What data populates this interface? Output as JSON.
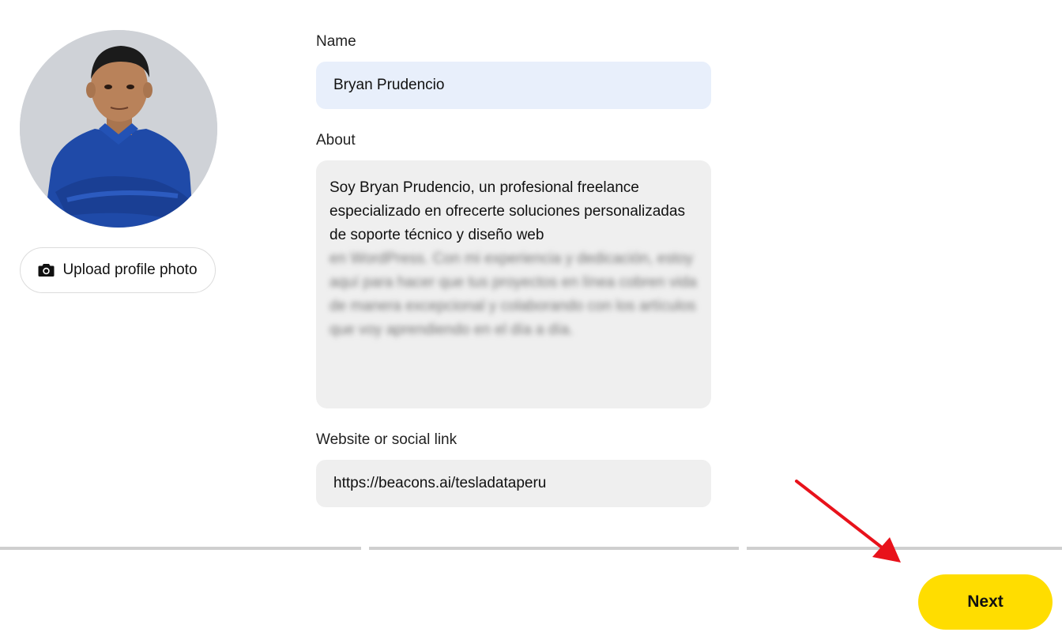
{
  "profile": {
    "upload_label": "Upload profile photo",
    "camera_icon": "camera-icon"
  },
  "form": {
    "name_label": "Name",
    "name_value": "Bryan Prudencio",
    "about_label": "About",
    "about_value_visible": "Soy Bryan Prudencio, un profesional freelance especializado en ofrecerte soluciones personalizadas de soporte técnico y diseño web",
    "about_value_blurred": "en WordPress. Con mi experiencia y dedicación, estoy aquí para hacer que tus proyectos en línea cobren vida de manera excepcional y colaborando con los artículos que voy aprendiendo en el día a día.",
    "website_label": "Website or social link",
    "website_value": "https://beacons.ai/tesladataperu"
  },
  "progress": {
    "total_steps": 3
  },
  "actions": {
    "next_label": "Next"
  },
  "colors": {
    "accent": "#ffdd00",
    "name_input_bg": "#e8effb",
    "input_bg": "#efefef",
    "progress_track": "#cfcfcf",
    "annotation_arrow": "#e8121b"
  }
}
